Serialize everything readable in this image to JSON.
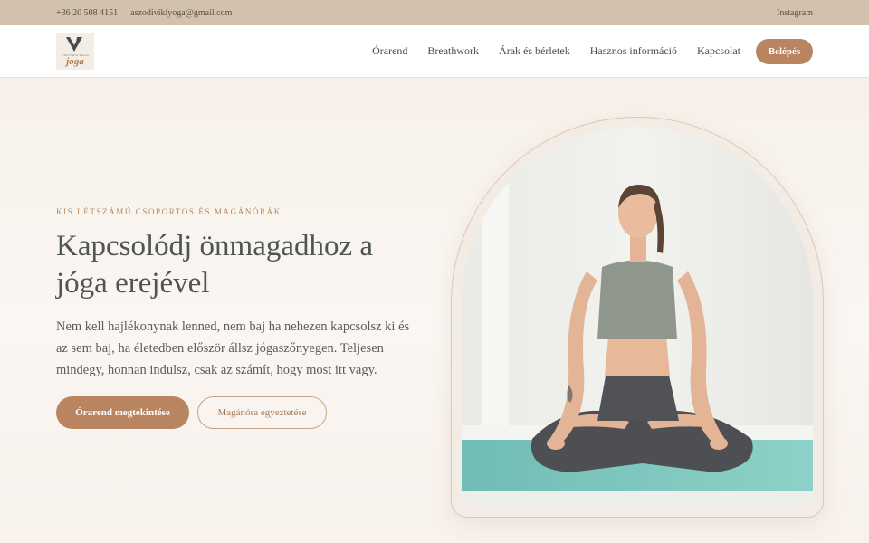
{
  "topbar": {
    "phone": "+36 20 508 4151",
    "email": "aszodivikiyoga@gmail.com",
    "instagram": "Instagram"
  },
  "logo": {
    "small_text": "VIKTÓRIA YOGA",
    "word": "joga"
  },
  "nav": {
    "items": [
      {
        "label": "Órarend"
      },
      {
        "label": "Breathwork"
      },
      {
        "label": "Árak és bérletek"
      },
      {
        "label": "Hasznos információ"
      },
      {
        "label": "Kapcsolat"
      }
    ],
    "login": "Belépés"
  },
  "hero": {
    "eyebrow": "Kis létszámú csoportos és magánórák",
    "title": "Kapcsolódj önmagadhoz a jóga erejével",
    "text": "Nem kell hajlékonynak lenned, nem baj ha nehezen kapcsolsz ki és az sem baj, ha életedben először állsz jógaszőnyegen. Teljesen mindegy, honnan indulsz, csak az számít, hogy most itt vagy.",
    "primary_button": "Órarend megtekintése",
    "secondary_button": "Magánóra egyeztetése"
  },
  "colors": {
    "accent": "#b98560",
    "topbar": "#d2c2ad",
    "heading": "#4f5550"
  }
}
